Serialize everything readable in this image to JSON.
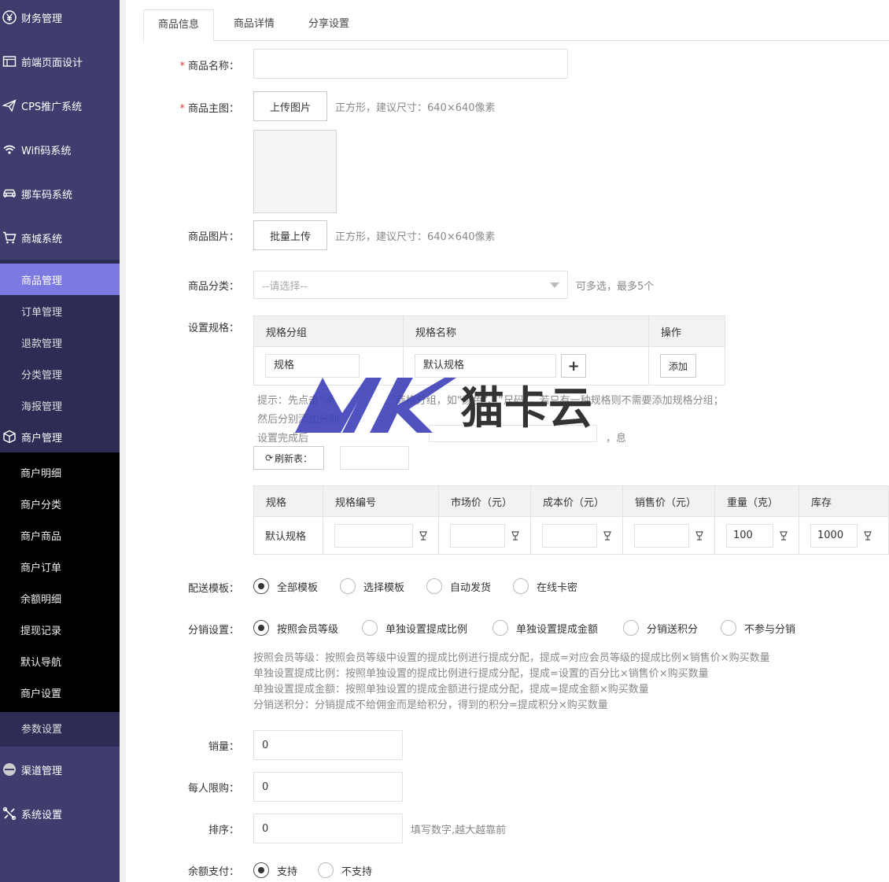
{
  "sidebar": {
    "top_items": [
      {
        "label": "财务管理",
        "icon": "yen-circle-icon"
      },
      {
        "label": "前端页面设计",
        "icon": "layout-icon"
      },
      {
        "label": "CPS推广系统",
        "icon": "send-icon"
      },
      {
        "label": "Wifi码系统",
        "icon": "wifi-icon"
      },
      {
        "label": "挪车码系统",
        "icon": "car-icon"
      },
      {
        "label": "商城系统",
        "icon": "cart-icon"
      }
    ],
    "mall_sub": [
      "商品管理",
      "订单管理",
      "退款管理",
      "分类管理",
      "海报管理"
    ],
    "merchant": {
      "label": "商户管理",
      "icon": "cube-icon"
    },
    "merchant_sub": [
      "商户明细",
      "商户分类",
      "商户商品",
      "商户订单",
      "余额明细",
      "提现记录",
      "默认导航",
      "商户设置"
    ],
    "param": "参数设置",
    "bottom_items": [
      {
        "label": "渠道管理",
        "icon": "circle-icon"
      },
      {
        "label": "系统设置",
        "icon": "tools-icon"
      }
    ]
  },
  "tabs": [
    "商品信息",
    "商品详情",
    "分享设置"
  ],
  "form": {
    "name_label": "商品名称：",
    "name_value": "",
    "main_image_label": "商品主图：",
    "upload_btn": "上传图片",
    "image_hint": "正方形，建议尺寸：640×640像素",
    "images_label": "商品图片：",
    "batch_upload_btn": "批量上传",
    "images_hint": "正方形，建议尺寸：640×640像素",
    "category_label": "商品分类：",
    "category_placeholder": "--请选择--",
    "category_hint": "可多选，最多5个",
    "spec_label": "设置规格：",
    "spec_table": {
      "headers": [
        "规格分组",
        "规格名称",
        "操作"
      ],
      "group_value": "规格",
      "name_value": "默认规格",
      "add_btn": "添加"
    },
    "spec_tip_1": "提示：先点击“添",
    "spec_tip_1b": "”商格分组，如“颜色”、“尺码”，若只有一种规格则不需要添加规格分组；",
    "spec_tip_2": "然后分别添加分别",
    "spec_tip_3": "设置完成后",
    "spec_tip_3b": "，息",
    "refresh_btn": "刷新表",
    "refresh_suffix": "：",
    "sku_table": {
      "headers": [
        "规格",
        "规格编号",
        "市场价（元）",
        "成本价（元）",
        "销售价（元）",
        "重量（克）",
        "库存"
      ],
      "row": {
        "spec": "默认规格",
        "code": "",
        "market": "",
        "cost": "",
        "sale": "",
        "weight": "100",
        "stock": "1000"
      }
    },
    "delivery_label": "配送模板：",
    "delivery_options": [
      "全部模板",
      "选择模板",
      "自动发货",
      "在线卡密"
    ],
    "dist_label": "分销设置：",
    "dist_options": [
      "按照会员等级",
      "单独设置提成比例",
      "单独设置提成金额",
      "分销送积分",
      "不参与分销"
    ],
    "dist_desc": [
      "按照会员等级：按照会员等级中设置的提成比例进行提成分配，提成=对应会员等级的提成比例×销售价×购买数量",
      "单独设置提成比例：按照单独设置的提成比例进行提成分配，提成=设置的百分比×销售价×购买数量",
      "单独设置提成金额：按照单独设置的提成金额进行提成分配，提成=提成金额×购买数量",
      "分销送积分：分销提成不给佣金而是给积分，得到的积分=提成积分×购买数量"
    ],
    "sales_label": "销量：",
    "sales_value": "0",
    "limit_label": "每人限购：",
    "limit_value": "0",
    "sort_label": "排序：",
    "sort_value": "0",
    "sort_hint": "填写数字,越大越靠前",
    "balance_label": "余额支付：",
    "balance_options": [
      "支持",
      "不支持"
    ]
  },
  "watermark": {
    "text": "猫卡云",
    "logo": "MK"
  },
  "colors": {
    "sidebar": "#3e3d6e",
    "active": "#7c7ae0",
    "accent": "#e33"
  }
}
